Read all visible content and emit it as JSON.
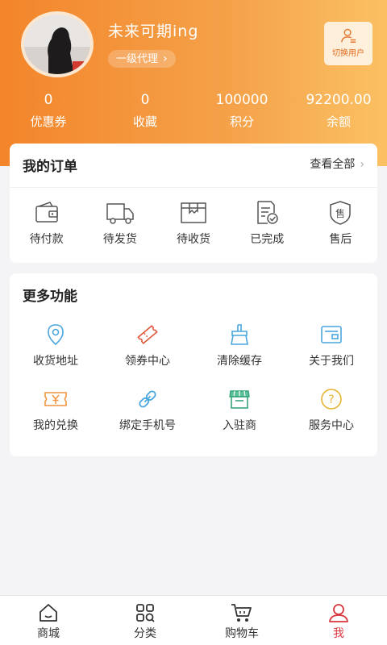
{
  "colors": {
    "gradient_start": "#f3852a",
    "gradient_end": "#fbc163",
    "active_tab": "#d9363e"
  },
  "profile": {
    "username": "未来可期ing",
    "level": "一级代理",
    "switch_user": "切换用户"
  },
  "stats": [
    {
      "value": "0",
      "label": "优惠券"
    },
    {
      "value": "0",
      "label": "收藏"
    },
    {
      "value": "100000",
      "label": "积分"
    },
    {
      "value": "92200.00",
      "label": "余额"
    }
  ],
  "orders": {
    "title": "我的订单",
    "view_all": "查看全部",
    "items": [
      {
        "label": "待付款",
        "icon": "wallet-icon"
      },
      {
        "label": "待发货",
        "icon": "truck-icon"
      },
      {
        "label": "待收货",
        "icon": "package-icon"
      },
      {
        "label": "已完成",
        "icon": "document-check-icon"
      },
      {
        "label": "售后",
        "icon": "after-sales-shield-icon"
      }
    ]
  },
  "more": {
    "title": "更多功能",
    "items": [
      {
        "label": "收货地址",
        "icon": "location-pin-icon"
      },
      {
        "label": "领券中心",
        "icon": "coupon-ticket-icon"
      },
      {
        "label": "清除缓存",
        "icon": "broom-icon"
      },
      {
        "label": "关于我们",
        "icon": "info-card-icon"
      },
      {
        "label": "我的兑换",
        "icon": "yen-ticket-icon"
      },
      {
        "label": "绑定手机号",
        "icon": "link-icon"
      },
      {
        "label": "入驻商",
        "icon": "storefront-icon"
      },
      {
        "label": "服务中心",
        "icon": "help-circle-icon"
      }
    ]
  },
  "tabbar": [
    {
      "label": "商城",
      "icon": "home-icon"
    },
    {
      "label": "分类",
      "icon": "category-grid-icon"
    },
    {
      "label": "购物车",
      "icon": "cart-icon"
    },
    {
      "label": "我",
      "icon": "user-icon",
      "active": true
    }
  ]
}
